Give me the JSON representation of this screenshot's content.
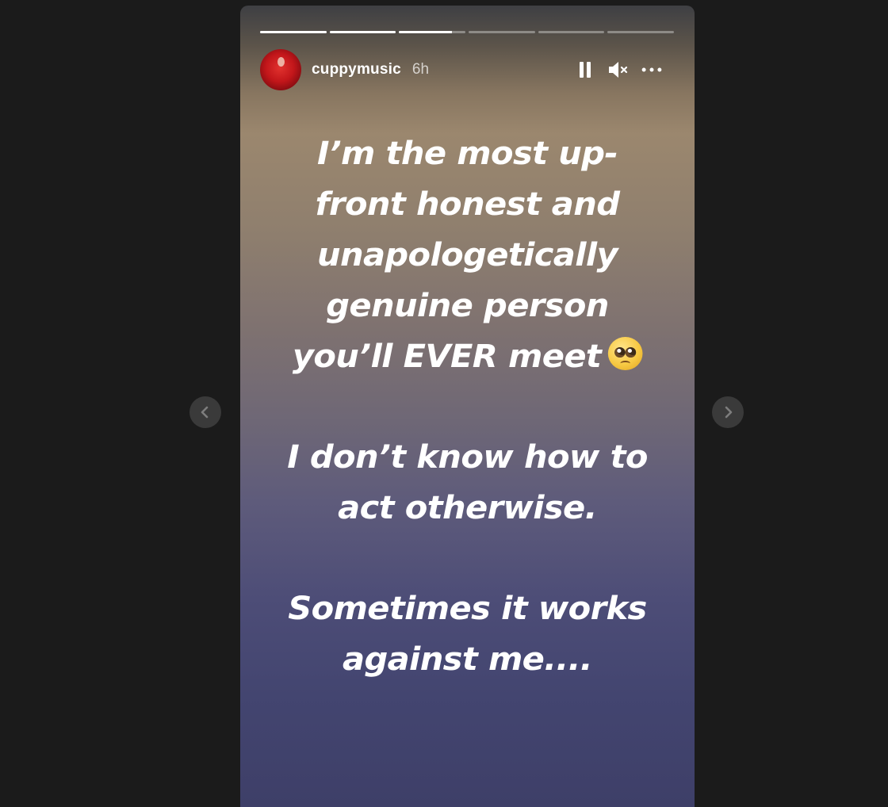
{
  "story": {
    "segments": [
      {
        "progress": 1.0
      },
      {
        "progress": 1.0
      },
      {
        "progress": 0.8
      },
      {
        "progress": 0.0
      },
      {
        "progress": 0.0
      },
      {
        "progress": 0.0
      }
    ],
    "username": "cuppymusic",
    "time": "6h",
    "controls": {
      "pause_icon": "pause-icon",
      "mute_icon": "muted-speaker-icon",
      "more_icon": "more-options-icon"
    },
    "text": {
      "paragraph_1": "I’m the most up-\nfront honest and\nunapologetically\ngenuine person\nyou’ll EVER meet",
      "emoji": "pleading-face-emoji",
      "paragraph_2": "I don’t know how to\nact otherwise.",
      "paragraph_3": "Sometimes it works\nagainst me...."
    }
  },
  "navigation": {
    "prev_icon": "chevron-left-icon",
    "next_icon": "chevron-right-icon"
  },
  "colors": {
    "background": "#1b1b1b",
    "story_top": "#9b876e",
    "story_bottom": "#3e3f68",
    "text": "#ffffff",
    "nav_button": "#3a3a3a"
  }
}
